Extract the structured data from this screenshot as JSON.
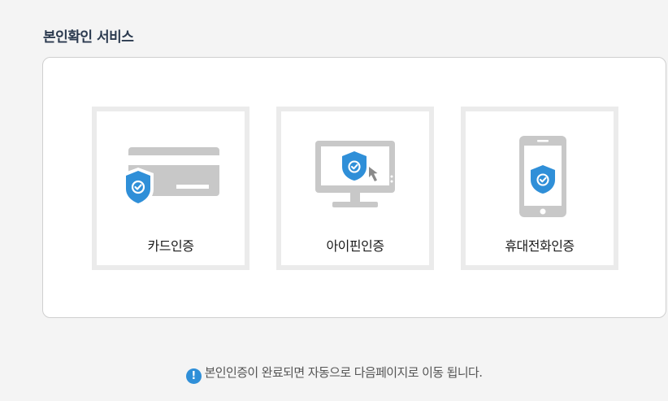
{
  "page": {
    "title": "본인확인 서비스"
  },
  "options": [
    {
      "label": "카드인증",
      "icon": "card-shield-icon"
    },
    {
      "label": "아이핀인증",
      "icon": "monitor-shield-icon"
    },
    {
      "label": "휴대전화인증",
      "icon": "phone-shield-icon"
    }
  ],
  "notice": {
    "icon": "exclamation-circle-icon",
    "icon_text": "!",
    "text": "본인인증이 완료되면 자동으로 다음페이지로 이동 됩니다."
  },
  "colors": {
    "shield": "#2f8fd8",
    "device": "#c8c8c8",
    "tile_border": "#ebebeb"
  }
}
